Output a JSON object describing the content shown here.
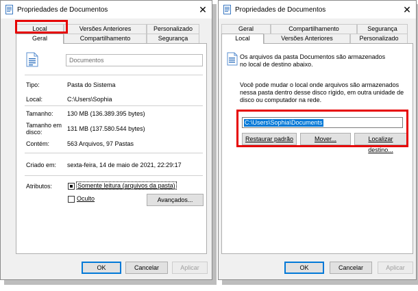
{
  "left_dialog": {
    "title": "Propriedades de Documentos",
    "tabs_back": [
      "Local",
      "Versões Anteriores",
      "Personalizado"
    ],
    "tabs_front": [
      "Geral",
      "Compartilhamento",
      "Segurança"
    ],
    "folder_name": "Documentos",
    "props": [
      {
        "label": "Tipo:",
        "value": "Pasta do Sistema"
      },
      {
        "label": "Local:",
        "value": "C:\\Users\\Sophia"
      },
      {
        "label": "Tamanho:",
        "value": "130 MB (136.389.395 bytes)"
      },
      {
        "label_line1": "Tamanho em",
        "label_line2": "disco:",
        "value": "131 MB (137.580.544 bytes)"
      },
      {
        "label": "Contém:",
        "value": "563 Arquivos, 97 Pastas"
      }
    ],
    "created_label": "Criado em:",
    "created_value": "sexta-feira, 14 de maio de 2021, 22:29:17",
    "attributes_label": "Atributos:",
    "readonly_label": "Somente leitura (arquivos da pasta)",
    "hidden_label": "Oculto",
    "advanced_label": "Avançados...",
    "ok": "OK",
    "cancel": "Cancelar",
    "apply": "Aplicar"
  },
  "right_dialog": {
    "title": "Propriedades de Documentos",
    "tabs_back": [
      "Geral",
      "Compartilhamento",
      "Segurança"
    ],
    "tabs_front": [
      "Local",
      "Versões Anteriores",
      "Personalizado"
    ],
    "info_line1": "Os arquivos da pasta Documentos são armazenados",
    "info_line2": "no local de destino abaixo.",
    "desc_line1": "Você pode mudar o local onde arquivos são armazenados",
    "desc_line2": "nessa pasta dentro desse disco rígido, em outra unidade de",
    "desc_line3": "disco ou computador na rede.",
    "path_value": "C:\\Users\\Sophia\\Documents",
    "restore_label": "Restaurar padrão",
    "move_label": "Mover...",
    "find_label": "Localizar destino...",
    "ok": "OK",
    "cancel": "Cancelar",
    "apply": "Aplicar"
  },
  "colors": {
    "highlight_red": "#e60000",
    "selection_blue": "#0078d7",
    "dialog_bg": "#f0f0f0"
  },
  "icons": [
    "folder-icon",
    "close-icon",
    "document-icon",
    "info-icon"
  ]
}
